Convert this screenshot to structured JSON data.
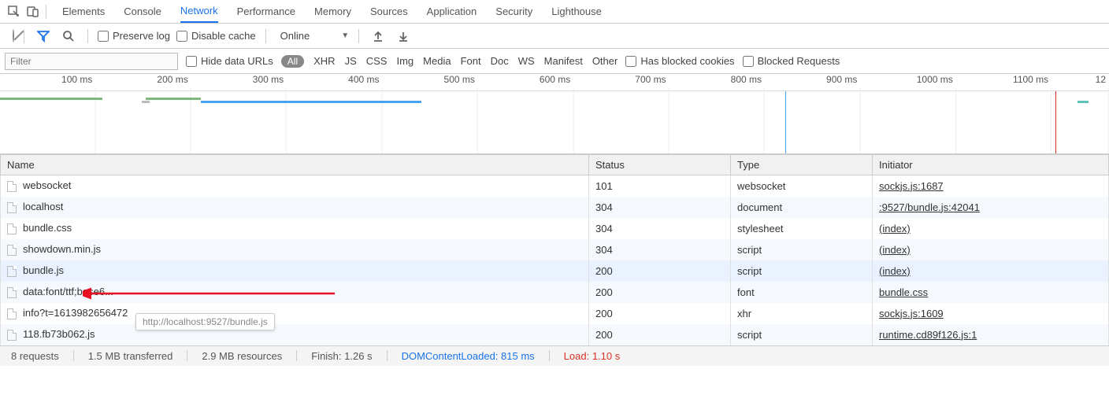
{
  "topTabs": [
    "Elements",
    "Console",
    "Network",
    "Performance",
    "Memory",
    "Sources",
    "Application",
    "Security",
    "Lighthouse"
  ],
  "activeTab": "Network",
  "controls": {
    "preserveLog": "Preserve log",
    "disableCache": "Disable cache",
    "throttling": "Online"
  },
  "filter": {
    "placeholder": "Filter",
    "hideDataUrls": "Hide data URLs",
    "types": [
      "All",
      "XHR",
      "JS",
      "CSS",
      "Img",
      "Media",
      "Font",
      "Doc",
      "WS",
      "Manifest",
      "Other"
    ],
    "hasBlockedCookies": "Has blocked cookies",
    "blockedRequests": "Blocked Requests"
  },
  "timeline": {
    "ticks": [
      "100 ms",
      "200 ms",
      "300 ms",
      "400 ms",
      "500 ms",
      "600 ms",
      "700 ms",
      "800 ms",
      "900 ms",
      "1000 ms",
      "1100 ms"
    ]
  },
  "columns": [
    "Name",
    "Status",
    "Type",
    "Initiator"
  ],
  "rows": [
    {
      "name": "websocket",
      "status": "101",
      "type": "websocket",
      "initiator": "sockjs.js:1687"
    },
    {
      "name": "localhost",
      "status": "304",
      "type": "document",
      "initiator": ":9527/bundle.js:42041"
    },
    {
      "name": "bundle.css",
      "status": "304",
      "type": "stylesheet",
      "initiator": "(index)"
    },
    {
      "name": "showdown.min.js",
      "status": "304",
      "type": "script",
      "initiator": "(index)"
    },
    {
      "name": "bundle.js",
      "status": "200",
      "type": "script",
      "initiator": "(index)"
    },
    {
      "name": "data:font/ttf;base6...",
      "status": "200",
      "type": "font",
      "initiator": "bundle.css",
      "grey": true
    },
    {
      "name": "info?t=1613982656472",
      "status": "200",
      "type": "xhr",
      "initiator": "sockjs.js:1609"
    },
    {
      "name": "118.fb73b062.js",
      "status": "200",
      "type": "script",
      "initiator": "runtime.cd89f126.js:1"
    }
  ],
  "highlightRow": 4,
  "tooltip": "http://localhost:9527/bundle.js",
  "summary": {
    "requests": "8 requests",
    "transferred": "1.5 MB transferred",
    "resources": "2.9 MB resources",
    "finish": "Finish: 1.26 s",
    "dcl": "DOMContentLoaded: 815 ms",
    "load": "Load: 1.10 s"
  }
}
